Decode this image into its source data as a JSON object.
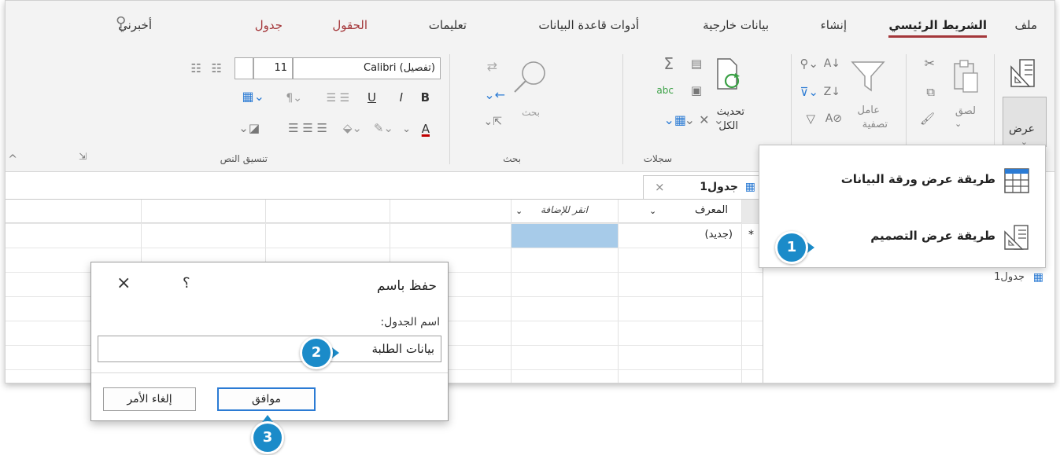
{
  "tabs": {
    "file": "ملف",
    "home": "الشريط الرئيسي",
    "create": "إنشاء",
    "external_data": "بيانات خارجية",
    "database_tools": "أدوات قاعدة البيانات",
    "help": "تعليمات",
    "fields": "الحقول",
    "table": "جدول",
    "tell_me": "أخبرني"
  },
  "ribbon": {
    "view_label": "عرض",
    "paste_label": "لصق",
    "filter_label": "عامل",
    "filter_label2": "تصفية",
    "refresh_label": "تحديث",
    "refresh_label2": "الكل",
    "records_group": "سجلات",
    "find_label": "بحث",
    "find_group": "بحث",
    "font_name": "(تفصيل) Calibri",
    "font_size": "11",
    "text_format_group": "تنسيق النص",
    "bold": "B",
    "italic": "I",
    "underline": "U",
    "font_color": "A",
    "accent_color": "#a4373a"
  },
  "document": {
    "tab_label": "جدول1",
    "col_id": "المعرف",
    "col_add": "انقر للإضافة",
    "new_row": "(جديد)",
    "new_row_marker": "*"
  },
  "nav": {
    "item": "جدول1"
  },
  "view_menu": {
    "datasheet_view": "طريقة عرض ورقة البيانات",
    "design_view": "طريقة عرض التصميم"
  },
  "dialog": {
    "title": "حفظ باسم",
    "help": "؟",
    "close": "×",
    "label": "اسم الجدول:",
    "value": "بيانات الطلبة",
    "ok": "موافق",
    "cancel": "إلغاء الأمر"
  },
  "steps": {
    "one": "1",
    "two": "2",
    "three": "3",
    "color": "#1b8bc9"
  }
}
